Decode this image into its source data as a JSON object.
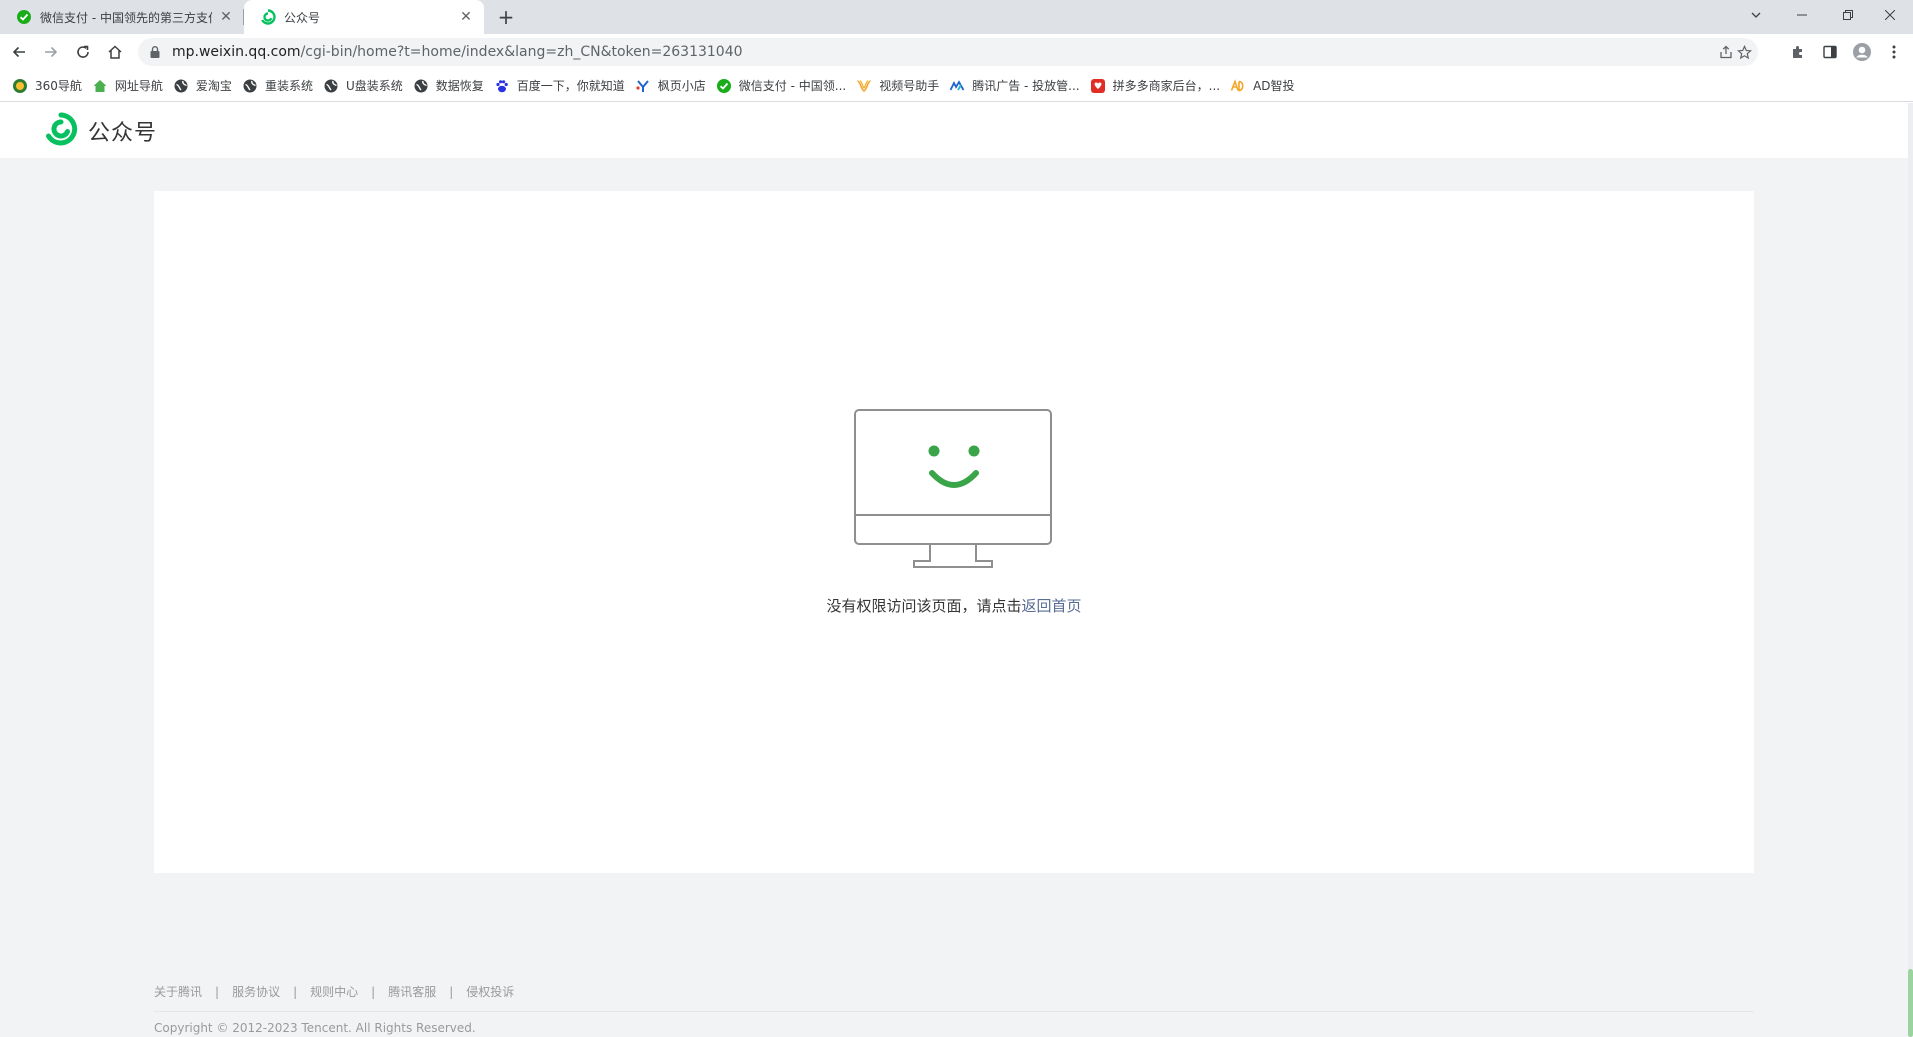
{
  "browser": {
    "tabs": [
      {
        "title": "微信支付 - 中国领先的第三方支付",
        "active": false,
        "favicon": "wechat-pay-icon"
      },
      {
        "title": "公众号",
        "active": true,
        "favicon": "mp-logo-icon"
      }
    ],
    "address_bar": {
      "host": "mp.weixin.qq.com",
      "path": "/cgi-bin/home?t=home/index&lang=zh_CN&token=263131040"
    },
    "bookmarks": [
      {
        "label": "360导航",
        "icon": "360-icon"
      },
      {
        "label": "网址导航",
        "icon": "house-icon"
      },
      {
        "label": "爱淘宝",
        "icon": "globe-icon"
      },
      {
        "label": "重装系统",
        "icon": "globe-icon"
      },
      {
        "label": "U盘装系统",
        "icon": "globe-icon"
      },
      {
        "label": "数据恢复",
        "icon": "globe-icon"
      },
      {
        "label": "百度一下，你就知道",
        "icon": "baidu-paw-icon"
      },
      {
        "label": "枫页小店",
        "icon": "maple-icon"
      },
      {
        "label": "微信支付 - 中国领...",
        "icon": "wechat-pay-icon"
      },
      {
        "label": "视频号助手",
        "icon": "channels-icon"
      },
      {
        "label": "腾讯广告 - 投放管...",
        "icon": "tencent-ads-icon"
      },
      {
        "label": "拼多多商家后台，...",
        "icon": "pinduoduo-icon"
      },
      {
        "label": "AD智投",
        "icon": "ad-icon"
      }
    ]
  },
  "header": {
    "brand": "公众号"
  },
  "error": {
    "message": "没有权限访问该页面，请点击",
    "link_text": "返回首页"
  },
  "footer": {
    "links": [
      "关于腾讯",
      "服务协议",
      "规则中心",
      "腾讯客服",
      "侵权投诉"
    ],
    "separator": "|",
    "copyright": "Copyright © 2012-2023 Tencent. All Rights Reserved."
  },
  "colors": {
    "brand_green": "#07c160",
    "link_blue": "#576b95",
    "page_bg": "#f2f3f5"
  }
}
